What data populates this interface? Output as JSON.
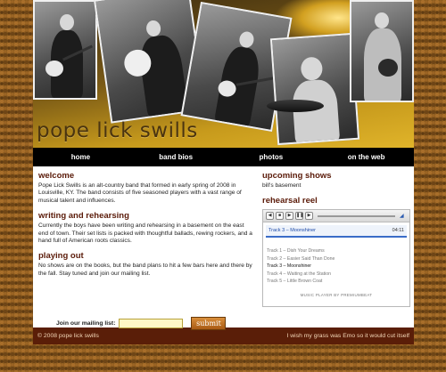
{
  "site": {
    "title": "pope lick swills"
  },
  "nav": [
    {
      "label": "home"
    },
    {
      "label": "band bios"
    },
    {
      "label": "photos"
    },
    {
      "label": "on the web"
    }
  ],
  "main": {
    "welcome": {
      "heading": "welcome",
      "text": "Pope Lick Swills is an alt-country band that formed in early spring of 2008 in Louisville, KY. The band consists of five seasoned players with a vast range of musical talent and influences."
    },
    "writing": {
      "heading": "writing and rehearsing",
      "text": "Currently the boys have been writing and rehearsing in a basement on the east end of town. Their set lists is packed with thoughtful ballads, rewing rockers, and a hand full of American roots classics."
    },
    "playing": {
      "heading": "playing out",
      "text": "No shows are on the books, but the band plans to hit a few bars here and there by the fall. Stay tuned and join our mailing list."
    },
    "mailing": {
      "label": "Join our mailing list:",
      "value": "",
      "submit_label": "submit"
    }
  },
  "sidebar": {
    "shows": {
      "heading": "upcoming shows",
      "text": "bill's basement"
    },
    "reel": {
      "heading": "rehearsal reel",
      "now_playing": "Track 3 – Moonshiner",
      "time": "04:11",
      "progress_fraction": 0.98,
      "tracks": [
        {
          "label": "Track 1 – Dish Your Dreams"
        },
        {
          "label": "Track 2 – Easier Said Than Done"
        },
        {
          "label": "Track 3 – Moonshiner"
        },
        {
          "label": "Track 4 – Waiting at the Station"
        },
        {
          "label": "Track 5 – Little Brown Coat"
        }
      ],
      "active_index": 2,
      "credit": "MUSIC PLAYER BY PREMIUMBEAT",
      "accent_color": "#3a6cc8"
    }
  },
  "footer": {
    "copyright": "© 2008 pope lick swills",
    "tagline": "I wish my grass was Emo so it would cut itself"
  },
  "colors": {
    "heading": "#5a1a08",
    "nav_bg": "#000000",
    "footer_bg": "#5a1e08",
    "background": "#8a5a1e"
  }
}
